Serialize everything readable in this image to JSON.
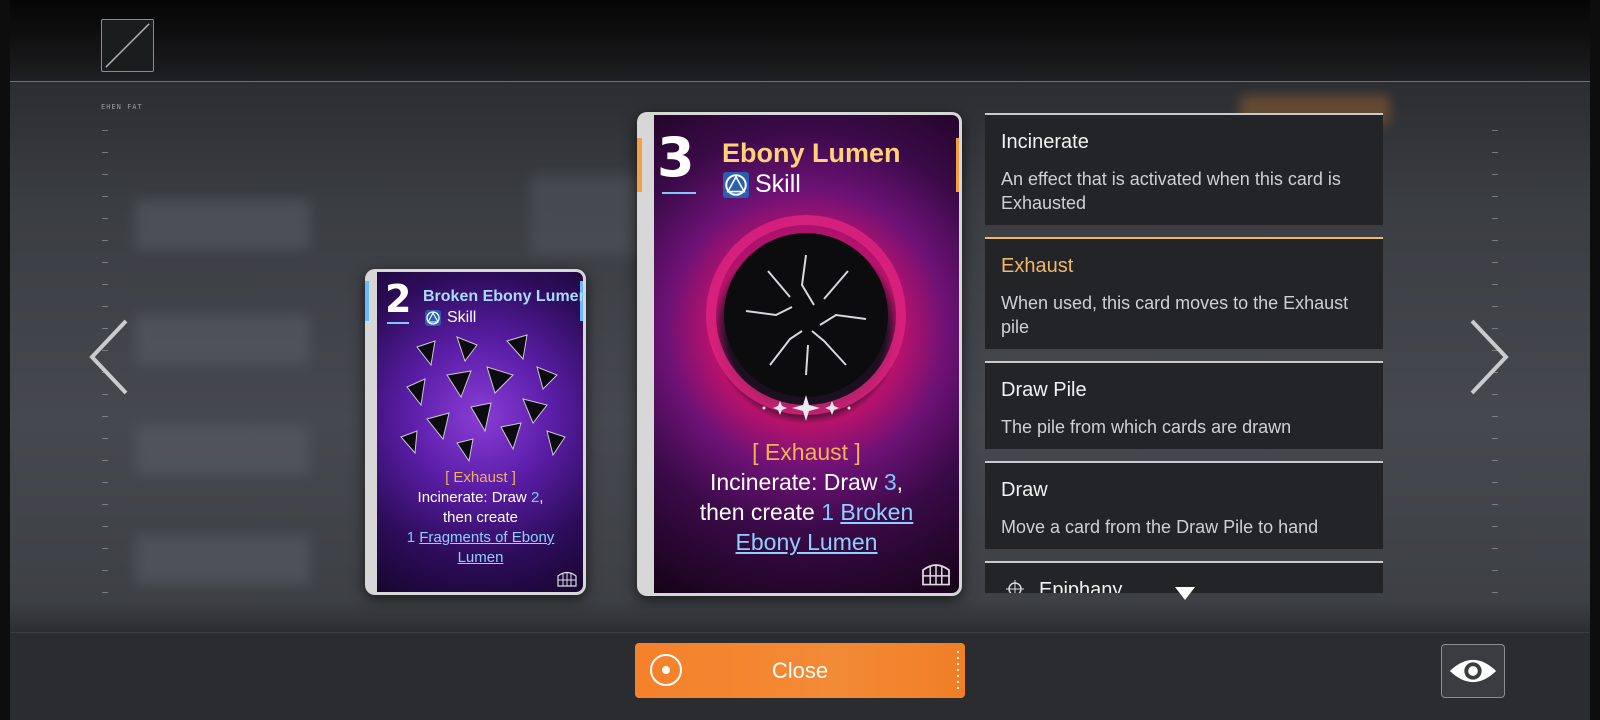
{
  "header": {
    "menu_icon": "frame-slash-icon",
    "deco_label": "EHEN FAT"
  },
  "colors": {
    "accent_orange": "#f5812a",
    "exhaust_gold": "#f0b356",
    "keyword_blue": "#8fd0ff",
    "panel_bg": "#232427"
  },
  "navigation": {
    "prev_icon": "chevron-left-icon",
    "next_icon": "chevron-right-icon"
  },
  "cards": {
    "secondary": {
      "cost": "2",
      "title": "Broken Ebony Lumen",
      "type": "Skill",
      "keyword": "[ Exhaust ]",
      "line1_prefix": "Incinerate: Draw ",
      "line1_num": "2",
      "line1_suffix": ",",
      "line2": "then create",
      "line3_num": "1",
      "line3_link": "Fragments of Ebony",
      "line4_link": "Lumen",
      "rarity_icon": "cage-rarity-icon"
    },
    "primary": {
      "cost": "3",
      "title": "Ebony Lumen",
      "type": "Skill",
      "keyword": "[ Exhaust ]",
      "line1_prefix": "Incinerate: Draw ",
      "line1_num": "3",
      "line1_suffix": ",",
      "line2_prefix": "then create ",
      "line2_num": "1",
      "line2_link": "Broken",
      "line3_link": "Ebony Lumen",
      "rarity_icon": "cage-rarity-icon"
    }
  },
  "glossary": [
    {
      "title": "Incinerate",
      "desc": "An effect that is activated when this card is Exhausted",
      "active": false
    },
    {
      "title": "Exhaust",
      "desc": "When used, this card moves to the Exhaust pile",
      "active": true
    },
    {
      "title": "Draw Pile",
      "desc": "The pile from which cards are drawn",
      "active": false
    },
    {
      "title": "Draw",
      "desc": "Move a card from the Draw Pile to hand",
      "active": false
    },
    {
      "title": "Epiphany",
      "desc": "",
      "active": false
    }
  ],
  "footer": {
    "close_label": "Close",
    "close_icon": "target-circle-icon",
    "eye_icon": "eye-icon"
  }
}
